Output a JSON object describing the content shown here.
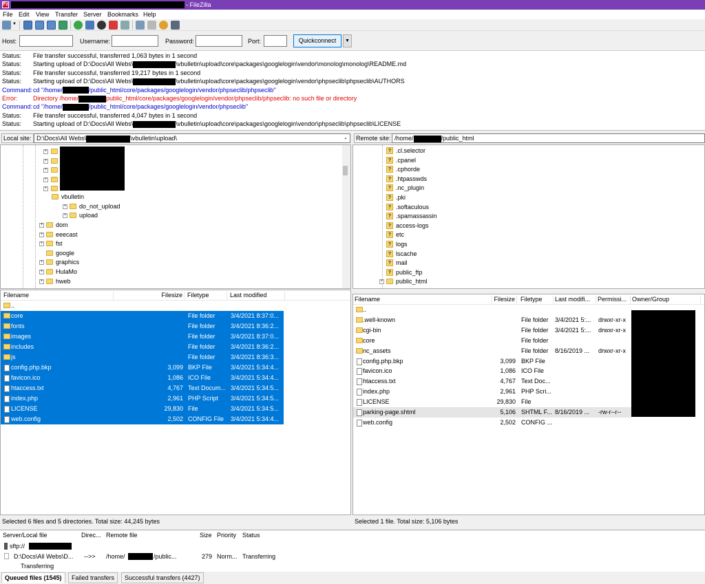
{
  "window": {
    "title": " - FileZilla",
    "app_icon": "Fz"
  },
  "menu": [
    "File",
    "Edit",
    "View",
    "Transfer",
    "Server",
    "Bookmarks",
    "Help"
  ],
  "quickconnect": {
    "host_label": "Host:",
    "username_label": "Username:",
    "password_label": "Password:",
    "port_label": "Port:",
    "button": "Quickconnect",
    "dropdown": "▼"
  },
  "log": [
    {
      "type": "Status:",
      "cls": "c-status",
      "pre": "File transfer successful, transferred 1,063 bytes in 1 second",
      "post": ""
    },
    {
      "type": "Status:",
      "cls": "c-status",
      "pre": "Starting upload of D:\\Docs\\All Webs\\",
      "post": "\\vbulletin\\upload\\core\\packages\\googlelogin\\vendor\\monolog\\monolog\\README.md"
    },
    {
      "type": "Status:",
      "cls": "c-status",
      "pre": "File transfer successful, transferred 19,217 bytes in 1 second",
      "post": ""
    },
    {
      "type": "Status:",
      "cls": "c-status",
      "pre": "Starting upload of D:\\Docs\\All Webs\\",
      "post": "\\vbulletin\\upload\\core\\packages\\googlelogin\\vendor\\phpseclib\\phpseclib\\AUTHORS"
    },
    {
      "type": "Command:",
      "cls": "c-cmd",
      "pre": "cd \"/home/",
      "post": "/public_html/core/packages/googlelogin/vendor/phpseclib/phpseclib\""
    },
    {
      "type": "Error:",
      "cls": "c-err",
      "pre": "Directory /home/",
      "post": "public_html/core/packages/googlelogin/vendor/phpseclib/phpseclib: no such file or directory"
    },
    {
      "type": "Command:",
      "cls": "c-cmd",
      "pre": "cd \"/home/",
      "post": "/public_html/core/packages/googlelogin/vendor/phpseclib\""
    },
    {
      "type": "Status:",
      "cls": "c-status",
      "pre": "File transfer successful, transferred 4,047 bytes in 1 second",
      "post": ""
    },
    {
      "type": "Status:",
      "cls": "c-status",
      "pre": "Starting upload of D:\\Docs\\All Webs\\",
      "post": "\\vbulletin\\upload\\core\\packages\\googlelogin\\vendor\\phpseclib\\phpseclib\\LICENSE"
    }
  ],
  "local": {
    "site_label": "Local site:",
    "path_pre": "D:\\Docs\\All Webs\\",
    "path_post": "\\vbulletin\\upload\\",
    "tree": [
      {
        "label": "vbulletin",
        "depth": 1
      },
      {
        "label": "do_not_upload",
        "depth": 2
      },
      {
        "label": "upload",
        "depth": 2
      },
      {
        "label": "dom",
        "depth": 0
      },
      {
        "label": "eeecast",
        "depth": 0
      },
      {
        "label": "fst",
        "depth": 0
      },
      {
        "label": "google",
        "depth": 0
      },
      {
        "label": "graphics",
        "depth": 0
      },
      {
        "label": "HulaMo",
        "depth": 0
      },
      {
        "label": "hweb",
        "depth": 0
      }
    ],
    "headers": {
      "name": "Filename",
      "size": "Filesize",
      "type": "Filetype",
      "modified": "Last modified"
    },
    "files": [
      {
        "name": "..",
        "size": "",
        "type": "",
        "modified": "",
        "dir": true,
        "sel": false
      },
      {
        "name": "core",
        "size": "",
        "type": "File folder",
        "modified": "3/4/2021 8:37:0...",
        "dir": true,
        "sel": true
      },
      {
        "name": "fonts",
        "size": "",
        "type": "File folder",
        "modified": "3/4/2021 8:36:2...",
        "dir": true,
        "sel": true
      },
      {
        "name": "images",
        "size": "",
        "type": "File folder",
        "modified": "3/4/2021 8:37:0...",
        "dir": true,
        "sel": true
      },
      {
        "name": "includes",
        "size": "",
        "type": "File folder",
        "modified": "3/4/2021 8:36:2...",
        "dir": true,
        "sel": true
      },
      {
        "name": "js",
        "size": "",
        "type": "File folder",
        "modified": "3/4/2021 8:36:3...",
        "dir": true,
        "sel": true
      },
      {
        "name": "config.php.bkp",
        "size": "3,099",
        "type": "BKP File",
        "modified": "3/4/2021 5:34:4...",
        "dir": false,
        "sel": true
      },
      {
        "name": "favicon.ico",
        "size": "1,086",
        "type": "ICO File",
        "modified": "3/4/2021 5:34:4...",
        "dir": false,
        "sel": true
      },
      {
        "name": "htaccess.txt",
        "size": "4,767",
        "type": "Text Docum...",
        "modified": "3/4/2021 5:34:5...",
        "dir": false,
        "sel": true
      },
      {
        "name": "index.php",
        "size": "2,961",
        "type": "PHP Script",
        "modified": "3/4/2021 5:34:5...",
        "dir": false,
        "sel": true
      },
      {
        "name": "LICENSE",
        "size": "29,830",
        "type": "File",
        "modified": "3/4/2021 5:34:5...",
        "dir": false,
        "sel": true
      },
      {
        "name": "web.config",
        "size": "2,502",
        "type": "CONFIG File",
        "modified": "3/4/2021 5:34:4...",
        "dir": false,
        "sel": true
      }
    ],
    "status": "Selected 6 files and 5 directories. Total size: 44,245 bytes"
  },
  "remote": {
    "site_label": "Remote site:",
    "path_pre": "/home/",
    "path_post": "/public_html",
    "tree": [
      {
        "label": ".cl.selector",
        "q": true
      },
      {
        "label": ".cpanel",
        "q": true
      },
      {
        "label": ".cphorde",
        "q": true
      },
      {
        "label": ".htpasswds",
        "q": true
      },
      {
        "label": ".nc_plugin",
        "q": true
      },
      {
        "label": ".pki",
        "q": true
      },
      {
        "label": ".softaculous",
        "q": true
      },
      {
        "label": ".spamassassin",
        "q": true
      },
      {
        "label": "access-logs",
        "q": true
      },
      {
        "label": "etc",
        "q": true
      },
      {
        "label": "logs",
        "q": true
      },
      {
        "label": "lscache",
        "q": true
      },
      {
        "label": "mail",
        "q": true
      },
      {
        "label": "public_ftp",
        "q": true
      },
      {
        "label": "public_html",
        "q": false
      }
    ],
    "headers": {
      "name": "Filename",
      "size": "Filesize",
      "type": "Filetype",
      "modified": "Last modifi...",
      "perm": "Permissi...",
      "owner": "Owner/Group"
    },
    "files": [
      {
        "name": "..",
        "size": "",
        "type": "",
        "modified": "",
        "perm": "",
        "dir": true
      },
      {
        "name": ".well-known",
        "size": "",
        "type": "File folder",
        "modified": "3/4/2021 5:...",
        "perm": "drwxr-xr-x",
        "dir": true
      },
      {
        "name": "cgi-bin",
        "size": "",
        "type": "File folder",
        "modified": "3/4/2021 5:...",
        "perm": "drwxr-xr-x",
        "dir": true
      },
      {
        "name": "core",
        "size": "",
        "type": "File folder",
        "modified": "",
        "perm": "",
        "dir": true
      },
      {
        "name": "nc_assets",
        "size": "",
        "type": "File folder",
        "modified": "8/16/2019 ...",
        "perm": "drwxr-xr-x",
        "dir": true
      },
      {
        "name": "config.php.bkp",
        "size": "3,099",
        "type": "BKP File",
        "modified": "",
        "perm": "",
        "dir": false
      },
      {
        "name": "favicon.ico",
        "size": "1,086",
        "type": "ICO File",
        "modified": "",
        "perm": "",
        "dir": false
      },
      {
        "name": "htaccess.txt",
        "size": "4,767",
        "type": "Text Doc...",
        "modified": "",
        "perm": "",
        "dir": false
      },
      {
        "name": "index.php",
        "size": "2,961",
        "type": "PHP Scri...",
        "modified": "",
        "perm": "",
        "dir": false
      },
      {
        "name": "LICENSE",
        "size": "29,830",
        "type": "File",
        "modified": "",
        "perm": "",
        "dir": false
      },
      {
        "name": "parking-page.shtml",
        "size": "5,106",
        "type": "SHTML F...",
        "modified": "8/16/2019 ...",
        "perm": "-rw-r--r--",
        "dir": false,
        "hover": true
      },
      {
        "name": "web.config",
        "size": "2,502",
        "type": "CONFIG ...",
        "modified": "",
        "perm": "",
        "dir": false
      }
    ],
    "status": "Selected 1 file. Total size: 5,106 bytes"
  },
  "queue": {
    "headers": {
      "server": "Server/Local file",
      "dir": "Direc...",
      "remote": "Remote file",
      "size": "Size",
      "priority": "Priority",
      "status": "Status"
    },
    "server": "sftp://",
    "local_file": "D:\\Docs\\All Webs\\D...",
    "direction": "-->>",
    "remote_pre": "/home/",
    "remote_post": "/public...",
    "size": "279",
    "priority": "Norm...",
    "status": "Transferring",
    "sub_status": "Transferring"
  },
  "tabs": [
    "Queued files (1545)",
    "Failed transfers",
    "Successful transfers (4427)"
  ],
  "colors": {
    "selection": "#0078d7",
    "titlebar": "#7a3fb5",
    "error": "#e00000",
    "command": "#0000cc"
  }
}
